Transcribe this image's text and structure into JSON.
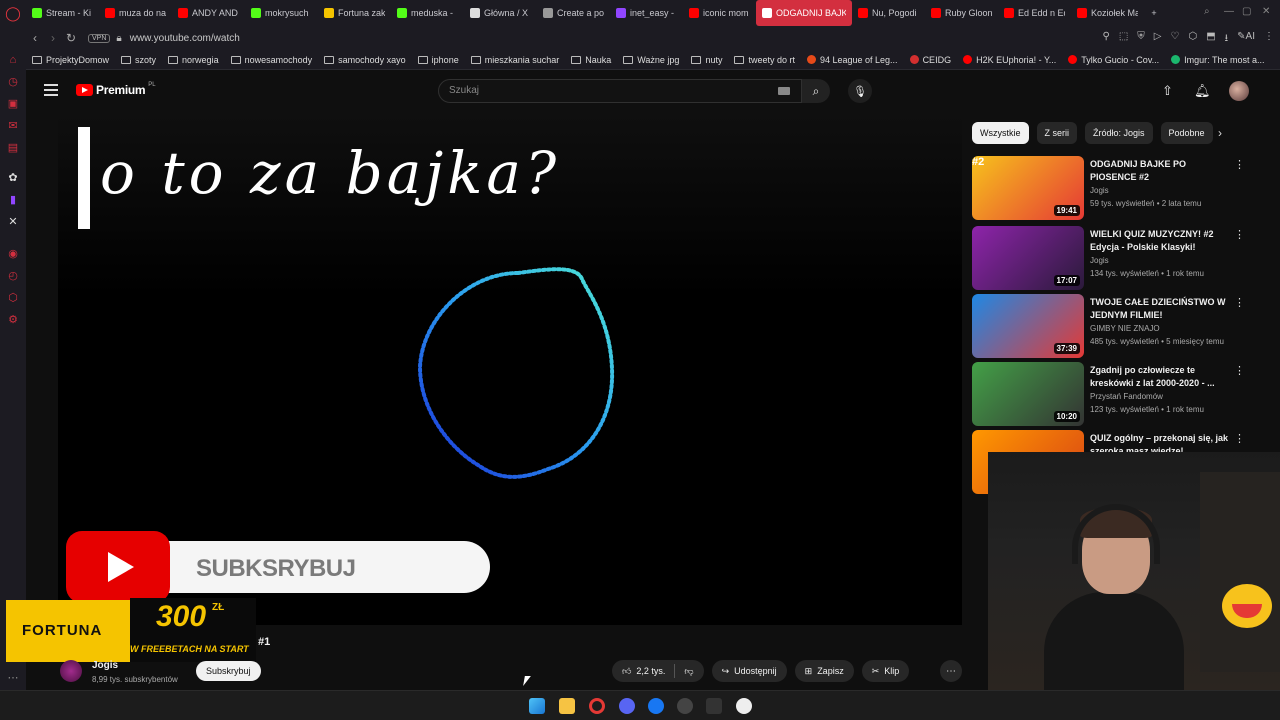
{
  "browser": {
    "tabs": [
      {
        "label": "Stream - Ki",
        "color": "#53fc18"
      },
      {
        "label": "muza do na",
        "color": "#ff0000"
      },
      {
        "label": "ANDY AND",
        "color": "#ff0000"
      },
      {
        "label": "mokrysuch",
        "color": "#53fc18"
      },
      {
        "label": "Fortuna zak",
        "color": "#f5c400"
      },
      {
        "label": "meduska -",
        "color": "#53fc18"
      },
      {
        "label": "Główna / X",
        "color": "#dddddd"
      },
      {
        "label": "Create a po",
        "color": "#999999"
      },
      {
        "label": "inet_easy -",
        "color": "#9146ff"
      },
      {
        "label": "iconic mom",
        "color": "#ff0000"
      },
      {
        "label": "ODGADNIJ BAJK",
        "color": "#ffffff",
        "active": true
      },
      {
        "label": "Nu, Pogodi",
        "color": "#ff0000"
      },
      {
        "label": "Ruby Gloon",
        "color": "#ff0000"
      },
      {
        "label": "Ed Edd n Ed",
        "color": "#ff0000"
      },
      {
        "label": "Koziołek Ma",
        "color": "#ff0000"
      }
    ],
    "new_tab": "+",
    "vpn": "VPN",
    "url": "www.youtube.com/watch",
    "ai_label": "AI",
    "bookmarks": [
      {
        "label": "ProjektyDomow",
        "kind": "folder"
      },
      {
        "label": "szoty",
        "kind": "folder"
      },
      {
        "label": "norwegia",
        "kind": "folder"
      },
      {
        "label": "nowesamochody",
        "kind": "folder"
      },
      {
        "label": "samochody xayo",
        "kind": "folder"
      },
      {
        "label": "iphone",
        "kind": "folder"
      },
      {
        "label": "mieszkania suchar",
        "kind": "folder"
      },
      {
        "label": "Nauka",
        "kind": "folder"
      },
      {
        "label": "Ważne jpg",
        "kind": "folder"
      },
      {
        "label": "nuty",
        "kind": "folder"
      },
      {
        "label": "tweety do rt",
        "kind": "folder"
      },
      {
        "label": "94 League of Leg...",
        "kind": "site",
        "color": "#e64a19"
      },
      {
        "label": "CEIDG",
        "kind": "site",
        "color": "#d32f2f"
      },
      {
        "label": "H2K EUphoria! - Y...",
        "kind": "site",
        "color": "#ff0000"
      },
      {
        "label": "Tylko Gucio - Cov...",
        "kind": "site",
        "color": "#ff0000"
      },
      {
        "label": "Imgur: The most a...",
        "kind": "site",
        "color": "#1bb76e"
      }
    ]
  },
  "youtube": {
    "logo_text": "Premium",
    "logo_superscript": "PL",
    "search_placeholder": "Szukaj",
    "video_title_text": "o to za bajka?",
    "overlay_subscribe": "SUBKSRYBUJ",
    "chips": [
      "Wszystkie",
      "Z serii",
      "Źródło: Jogis",
      "Podobne"
    ],
    "recommendations": [
      {
        "rank": "#2",
        "title": "ODGADNIJ BAJKE PO PIOSENCE #2",
        "channel": "Jogis",
        "meta": "59 tys. wyświetleń • 2 lata temu",
        "duration": "19:41",
        "thumb_colors": [
          "#f7c21c",
          "#e53935"
        ]
      },
      {
        "rank": "",
        "title": "WIELKI QUIZ MUZYCZNY! #2 Edycja - Polskie Klasyki!",
        "channel": "Jogis",
        "meta": "134 tys. wyświetleń • 1 rok temu",
        "duration": "17:07",
        "thumb_colors": [
          "#8e24aa",
          "#2a1a3a"
        ]
      },
      {
        "rank": "",
        "title": "TWOJE CAŁE DZIECIŃSTWO W JEDNYM FILMIE!",
        "channel": "GIMBY NIE ZNAJO",
        "meta": "485 tys. wyświetleń • 5 miesięcy temu",
        "duration": "37:39",
        "thumb_colors": [
          "#1e88e5",
          "#e53935"
        ]
      },
      {
        "rank": "",
        "title": "Zgadnij po człowiecze te kreskówki z lat 2000-2020 - ...",
        "channel": "Przystań Fandomów",
        "meta": "123 tys. wyświetleń • 1 rok temu",
        "duration": "10:20",
        "thumb_colors": [
          "#43a047",
          "#333333"
        ]
      },
      {
        "rank": "",
        "title": "QUIZ ogólny – przekonaj się, jak szeroka masz wiedzę!",
        "channel": "",
        "meta": "",
        "duration": "",
        "thumb_colors": [
          "#ff9800",
          "#d84315"
        ]
      }
    ],
    "channel": {
      "name": "Jogis",
      "subscribers": "8,99 tys. subskrybentów"
    },
    "subscribe_button": "Subskrybuj",
    "actions": {
      "likes": "2,2 tys.",
      "share": "Udostępnij",
      "save": "Zapisz",
      "clip": "Klip"
    },
    "ad": {
      "brand": "FORTUNA",
      "amount": "300",
      "currency": "ZŁ",
      "promo": "W FREEBETACH NA START"
    },
    "ad_rank": "#1"
  },
  "colors": {
    "accent": "#ff0000",
    "tab_active": "#d32f3f",
    "ad_yellow": "#f5c400"
  }
}
